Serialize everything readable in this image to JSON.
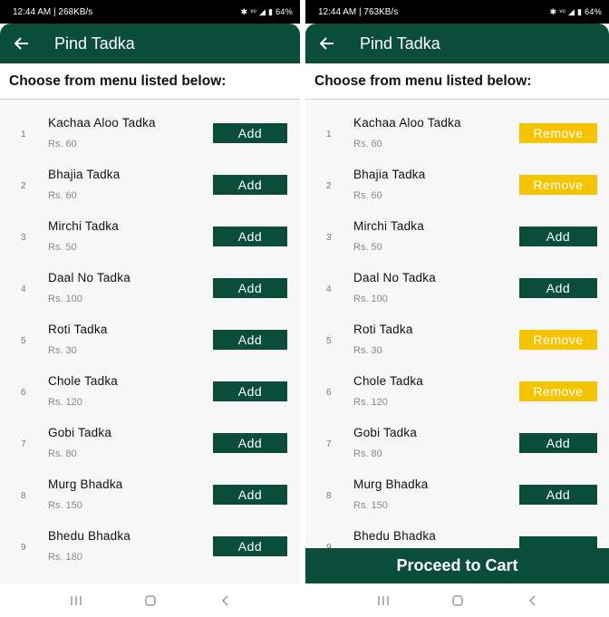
{
  "colors": {
    "primary": "#0a4d3a",
    "remove": "#f5c400"
  },
  "left": {
    "status": {
      "time_info": "12:44 AM | 268KB/s",
      "icons": "✱ ᵛᵒ ◢ ▮ 64%"
    },
    "appbar": {
      "title": "Pind Tadka"
    },
    "heading": "Choose from menu listed below:",
    "items": [
      {
        "num": "1",
        "name": "Kachaa Aloo Tadka",
        "price": "Rs. 60",
        "button": "Add",
        "state": "add"
      },
      {
        "num": "2",
        "name": "Bhajia Tadka",
        "price": "Rs. 60",
        "button": "Add",
        "state": "add"
      },
      {
        "num": "3",
        "name": "Mirchi Tadka",
        "price": "Rs. 50",
        "button": "Add",
        "state": "add"
      },
      {
        "num": "4",
        "name": "Daal No Tadka",
        "price": "Rs. 100",
        "button": "Add",
        "state": "add"
      },
      {
        "num": "5",
        "name": "Roti Tadka",
        "price": "Rs. 30",
        "button": "Add",
        "state": "add"
      },
      {
        "num": "6",
        "name": "Chole Tadka",
        "price": "Rs. 120",
        "button": "Add",
        "state": "add"
      },
      {
        "num": "7",
        "name": "Gobi Tadka",
        "price": "Rs. 80",
        "button": "Add",
        "state": "add"
      },
      {
        "num": "8",
        "name": "Murg Bhadka",
        "price": "Rs. 150",
        "button": "Add",
        "state": "add"
      },
      {
        "num": "9",
        "name": "Bhedu Bhadka",
        "price": "Rs. 180",
        "button": "Add",
        "state": "add"
      }
    ]
  },
  "right": {
    "status": {
      "time_info": "12:44 AM | 763KB/s",
      "icons": "✱ ᵛᵒ ◢ ▮ 64%"
    },
    "appbar": {
      "title": "Pind Tadka"
    },
    "heading": "Choose from menu listed below:",
    "items": [
      {
        "num": "1",
        "name": "Kachaa Aloo Tadka",
        "price": "Rs. 60",
        "button": "Remove",
        "state": "remove"
      },
      {
        "num": "2",
        "name": "Bhajia Tadka",
        "price": "Rs. 60",
        "button": "Remove",
        "state": "remove"
      },
      {
        "num": "3",
        "name": "Mirchi Tadka",
        "price": "Rs. 50",
        "button": "Add",
        "state": "add"
      },
      {
        "num": "4",
        "name": "Daal No Tadka",
        "price": "Rs. 100",
        "button": "Add",
        "state": "add"
      },
      {
        "num": "5",
        "name": "Roti Tadka",
        "price": "Rs. 30",
        "button": "Remove",
        "state": "remove"
      },
      {
        "num": "6",
        "name": "Chole Tadka",
        "price": "Rs. 120",
        "button": "Remove",
        "state": "remove"
      },
      {
        "num": "7",
        "name": "Gobi Tadka",
        "price": "Rs. 80",
        "button": "Add",
        "state": "add"
      },
      {
        "num": "8",
        "name": "Murg Bhadka",
        "price": "Rs. 150",
        "button": "Add",
        "state": "add"
      },
      {
        "num": "9",
        "name": "Bhedu Bhadka",
        "price": "",
        "button": "",
        "state": "add"
      }
    ],
    "proceed_label": "Proceed to Cart"
  }
}
